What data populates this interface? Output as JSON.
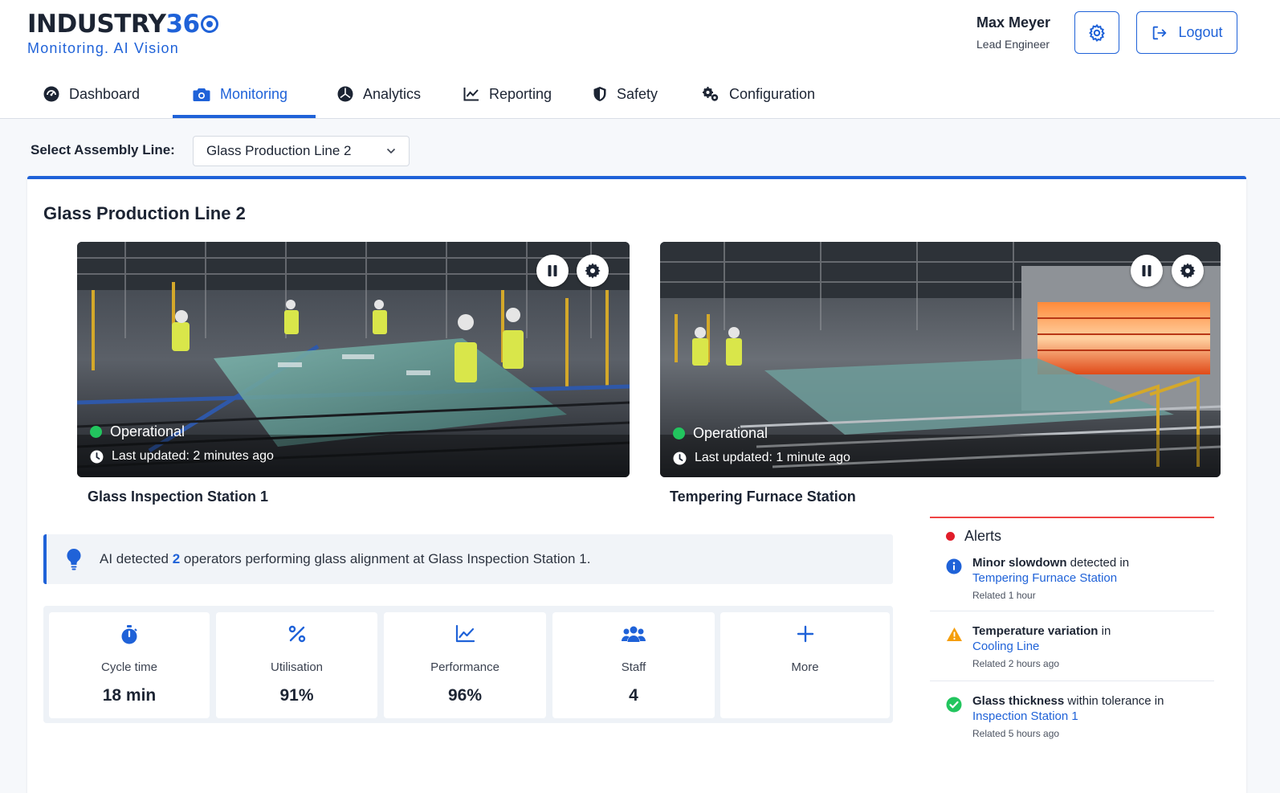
{
  "brand": {
    "name": "INDUSTRY",
    "num": "36",
    "tagline": "Monitoring. AI Vision"
  },
  "user": {
    "name": "Max Meyer",
    "role": "Lead Engineer"
  },
  "header": {
    "settings_icon": "gear-icon",
    "logout_label": "Logout"
  },
  "nav": [
    {
      "label": "Dashboard",
      "icon": "dashboard-gauge-icon"
    },
    {
      "label": "Monitoring",
      "icon": "camera-icon",
      "active": true
    },
    {
      "label": "Analytics",
      "icon": "pie-chart-icon"
    },
    {
      "label": "Reporting",
      "icon": "line-chart-icon"
    },
    {
      "label": "Safety",
      "icon": "shield-icon"
    },
    {
      "label": "Configuration",
      "icon": "cogs-icon"
    }
  ],
  "selector": {
    "label": "Select Assembly Line:",
    "value": "Glass Production Line 2"
  },
  "panel": {
    "title": "Glass Production Line 2"
  },
  "cameras": [
    {
      "name": "Glass Inspection Station 1",
      "status": "Operational",
      "updated": "Last updated: 2 minutes ago"
    },
    {
      "name": "Tempering Furnace Station",
      "status": "Operational",
      "updated": "Last updated: 1 minute ago"
    }
  ],
  "insight": {
    "prefix": "AI detected ",
    "count": "2",
    "suffix": " operators performing glass alignment at Glass Inspection Station 1."
  },
  "metrics": [
    {
      "label": "Cycle time",
      "value": "18 min",
      "icon": "stopwatch-icon"
    },
    {
      "label": "Utilisation",
      "value": "91%",
      "icon": "percent-icon"
    },
    {
      "label": "Performance",
      "value": "96%",
      "icon": "chart-line-icon"
    },
    {
      "label": "Staff",
      "value": "4",
      "icon": "users-icon"
    },
    {
      "label": "More",
      "value": "",
      "icon": "plus-icon"
    }
  ],
  "alerts": {
    "title": "Alerts",
    "items": [
      {
        "bold": "Minor slowdown",
        "rest": " detected in",
        "link": "Tempering Furnace Station",
        "time": "Related 1 hour",
        "type": "info"
      },
      {
        "bold": "Temperature variation",
        "rest": " in",
        "link": "Cooling Line",
        "time": "Related 2 hours ago",
        "type": "warning"
      },
      {
        "bold": "Glass thickness",
        "rest": " within tolerance in",
        "link": "Inspection Station 1",
        "time": "Related 5 hours ago",
        "type": "success"
      }
    ]
  },
  "colors": {
    "accent": "#1f62d8",
    "success": "#22c55e",
    "warning": "#f59e0b",
    "danger": "#e11d2a"
  }
}
